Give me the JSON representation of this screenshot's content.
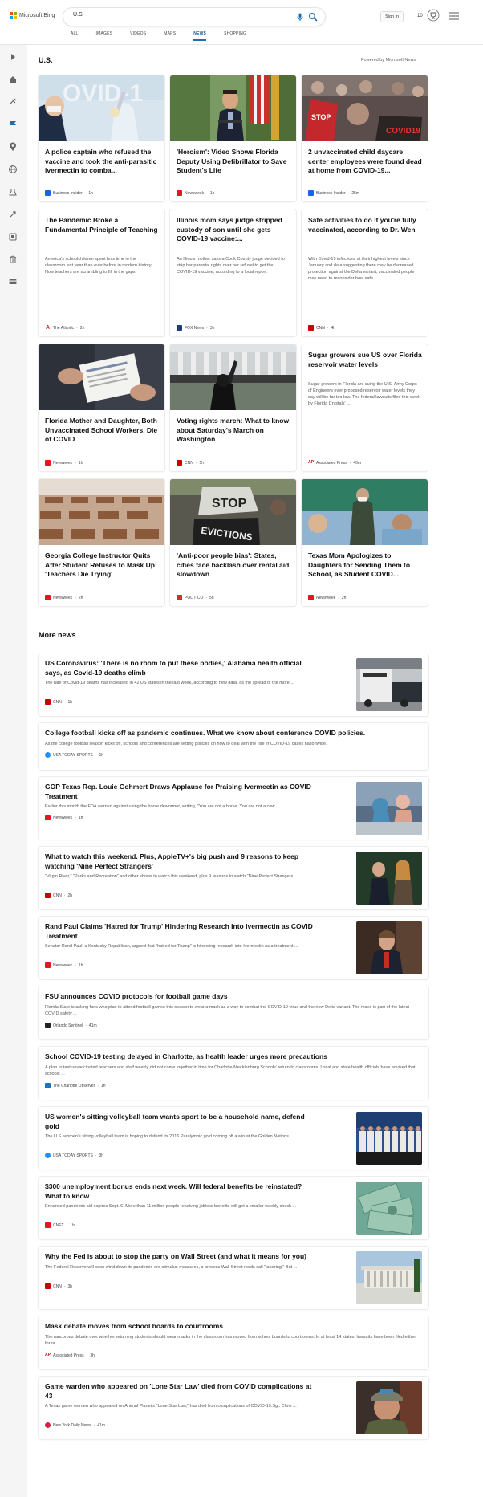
{
  "header": {
    "brand": "Microsoft Bing",
    "search_value": "U.S.",
    "signin_label": "Sign in",
    "reward_count": "10",
    "tabs": [
      {
        "label": "ALL"
      },
      {
        "label": "IMAGES"
      },
      {
        "label": "VIDEOS"
      },
      {
        "label": "MAPS"
      },
      {
        "label": "NEWS",
        "active": true
      },
      {
        "label": "SHOPPING"
      }
    ]
  },
  "rail": {
    "icons": [
      "expand-icon",
      "home-icon",
      "scitech-icon",
      "flag-icon",
      "location-icon",
      "globe-icon",
      "science-icon",
      "rocket-icon",
      "entertainment-icon",
      "business-icon",
      "card-icon"
    ]
  },
  "main": {
    "section_title": "U.S.",
    "powered_by": "Powered by Microsoft News",
    "cards": [
      {
        "title": "A police captain who refused the vaccine and took the anti-parasitic ivermectin to comba...",
        "source": "Business Insider",
        "time": "1h",
        "image": "vaccine-photo"
      },
      {
        "title": "'Heroism': Video Shows Florida Deputy Using Defibrillator to Save Student's Life",
        "source": "Newsweek",
        "time": "1h",
        "image": "press-conference-photo"
      },
      {
        "title": "2 unvaccinated child daycare center employees were found dead at home from COVID-19...",
        "source": "Business Insider",
        "time": "25m",
        "image": "protest-photo"
      },
      {
        "title": "The Pandemic Broke a Fundamental Principle of Teaching",
        "snippet": "America's schoolchildren spent less time in the classroom last year than ever before in modern history. Now teachers are scrambling to fill in the gaps.",
        "source": "The Atlantic",
        "time": "2h"
      },
      {
        "title": "Illinois mom says judge stripped custody of son until she gets COVID-19 vaccine:...",
        "snippet": "An Illinois mother says a Cook County judge decided to strip her parental rights over her refusal to get the COVID-19 vaccine, according to a local report.",
        "source": "FOX News",
        "time": "3h"
      },
      {
        "title": "Safe activities to do if you're fully vaccinated, according to Dr. Wen",
        "snippet": "With Covid-19 infections at their highest levels since January and data suggesting there may be decreased protection against the Delta variant, vaccinated people may need to reconsider how safe ...",
        "source": "CNN",
        "time": "4h"
      },
      {
        "title": "Florida Mother and Daughter, Both Unvaccinated School Workers, Die of COVID",
        "source": "Newsweek",
        "time": "1h",
        "image": "vaccine-card-photo"
      },
      {
        "title": "Voting rights march: What to know about Saturday's March on Washington",
        "source": "CNN",
        "time": "5h",
        "image": "march-photo"
      },
      {
        "title": "Sugar growers sue US over Florida reservoir water levels",
        "snippet": "Sugar growers in Florida are suing the U.S. Army Corps of Engineers over proposed reservoir water levels they say will be far too low. The federal lawsuits filed this week by Florida Crystals' ...",
        "source": "Associated Press",
        "time": "40m"
      },
      {
        "title": "Georgia College Instructor Quits After Student Refuses to Mask Up: 'Teachers Die Trying'",
        "source": "Newsweek",
        "time": "2h",
        "image": "classroom-photo"
      },
      {
        "title": "'Anti-poor people bias': States, cities face backlash over rental aid slowdown",
        "source": "POLITICO",
        "time": "5h",
        "image": "stop-evictions-photo"
      },
      {
        "title": "Texas Mom Apologizes to Daughters for Sending Them to School, as Student COVID...",
        "source": "Newsweek",
        "time": "2h",
        "image": "school-photo"
      }
    ],
    "more_title": "More news",
    "more": [
      {
        "title": "US Coronavirus: 'There is no room to put these bodies,' Alabama health official says, as Covid-19 deaths climb",
        "snippet": "The rate of Covid-19 deaths has increased in 42 US states in the last week, according to new data, as the spread of the more ...",
        "source": "CNN",
        "time": "1h",
        "thumb": "ambulance-photo"
      },
      {
        "title": "College football kicks off as pandemic continues. What we know about conference COVID policies.",
        "snippet": "As the college football season kicks off, schools and conferences are setting policies on how to deal with the rise in COVID-19 cases nationwide.",
        "source": "USA TODAY SPORTS",
        "time": "1h"
      },
      {
        "title": "GOP Texas Rep. Louie Gohmert Draws Applause for Praising Ivermectin as COVID Treatment",
        "snippet": "Earlier this month the FDA warned against using the horse dewormer, writing, \"You are not a horse. You are not a cow.",
        "source": "Newsweek",
        "time": "1h",
        "thumb": "hospital-photo"
      },
      {
        "title": "What to watch this weekend. Plus, AppleTV+'s big push and 9 reasons to keep watching 'Nine Perfect Strangers'",
        "snippet": "\"Virgin River,\" \"Parks and Recreation\" and other shows to watch this weekend, plus 9 reasons to watch \"Nine Perfect Strangers ...",
        "source": "CNN",
        "time": "2h",
        "thumb": "tv-photo"
      },
      {
        "title": "Rand Paul Claims 'Hatred for Trump' Hindering Research Into Ivermectin as COVID Treatment",
        "snippet": "Senator Rand Paul, a Kentucky Republican, argued that \"hatred for Trump\" is hindering research into Ivermectin as a treatment ...",
        "source": "Newsweek",
        "time": "1h",
        "thumb": "senator-photo"
      },
      {
        "title": "FSU announces COVID protocols for football game days",
        "snippet": "Florida State is asking fans who plan to attend football games this season to wear a mask as a way to combat the COVID-19 virus and the new Delta variant. The move is part of the latest COVID safety ...",
        "source": "Orlando Sentinel",
        "time": "41m"
      },
      {
        "title": "School COVID-19 testing delayed in Charlotte, as health leader urges more precautions",
        "snippet": "A plan to test unvaccinated teachers and staff weekly did not come together in time for Charlotte-Mecklenburg Schools' return to classrooms. Local and state health officials have advised that schools ...",
        "source": "The Charlotte Observer",
        "time": "1h"
      },
      {
        "title": "US women's sitting volleyball team wants sport to be a household name, defend gold",
        "snippet": "The U.S. women's sitting volleyball team is hoping to defend its 2016 Paralympic gold coming off a win at the Golden Nations ...",
        "source": "USA TODAY SPORTS",
        "time": "3h",
        "thumb": "team-photo"
      },
      {
        "title": "$300 unemployment bonus ends next week. Will federal benefits be reinstated? What to know",
        "snippet": "Enhanced pandemic aid expires Sept. 6. More than 11 million people receiving jobless benefits will get a smaller weekly check ...",
        "source": "CNET",
        "time": "1h",
        "thumb": "money-photo"
      },
      {
        "title": "Why the Fed is about to stop the party on Wall Street (and what it means for you)",
        "snippet": "The Federal Reserve will soon wind down its pandemic-era stimulus measures, a process Wall Street nerds call \"tapering.\" But ...",
        "source": "CNN",
        "time": "3h",
        "thumb": "fed-building-photo"
      },
      {
        "title": "Mask debate moves from school boards to courtrooms",
        "snippet": "The rancorous debate over whether returning students should wear masks in the classroom has moved from school boards to courtrooms. In at least 14 states, lawsuits have been filed either for or ...",
        "source": "Associated Press",
        "time": "3h"
      },
      {
        "title": "Game warden who appeared on 'Lone Star Law' died from COVID complications at 43",
        "snippet": "A Texas game warden who appeared on Animal Planet's \"Lone Star Law,\" has died from complications of COVID-19.Sgt. Chris ...",
        "source": "New York Daily News",
        "time": "41m",
        "thumb": "warden-photo"
      }
    ]
  },
  "colors": {
    "accent": "#1a6fb3",
    "business_insider": "#1565e8",
    "newsweek": "#e8141f",
    "cnn": "#cc0000",
    "fox": "#1d3b75",
    "ap": "#cc0000",
    "politico": "#d92b2b",
    "usa_today": "#1e90ff",
    "cnet": "#e8141f"
  }
}
